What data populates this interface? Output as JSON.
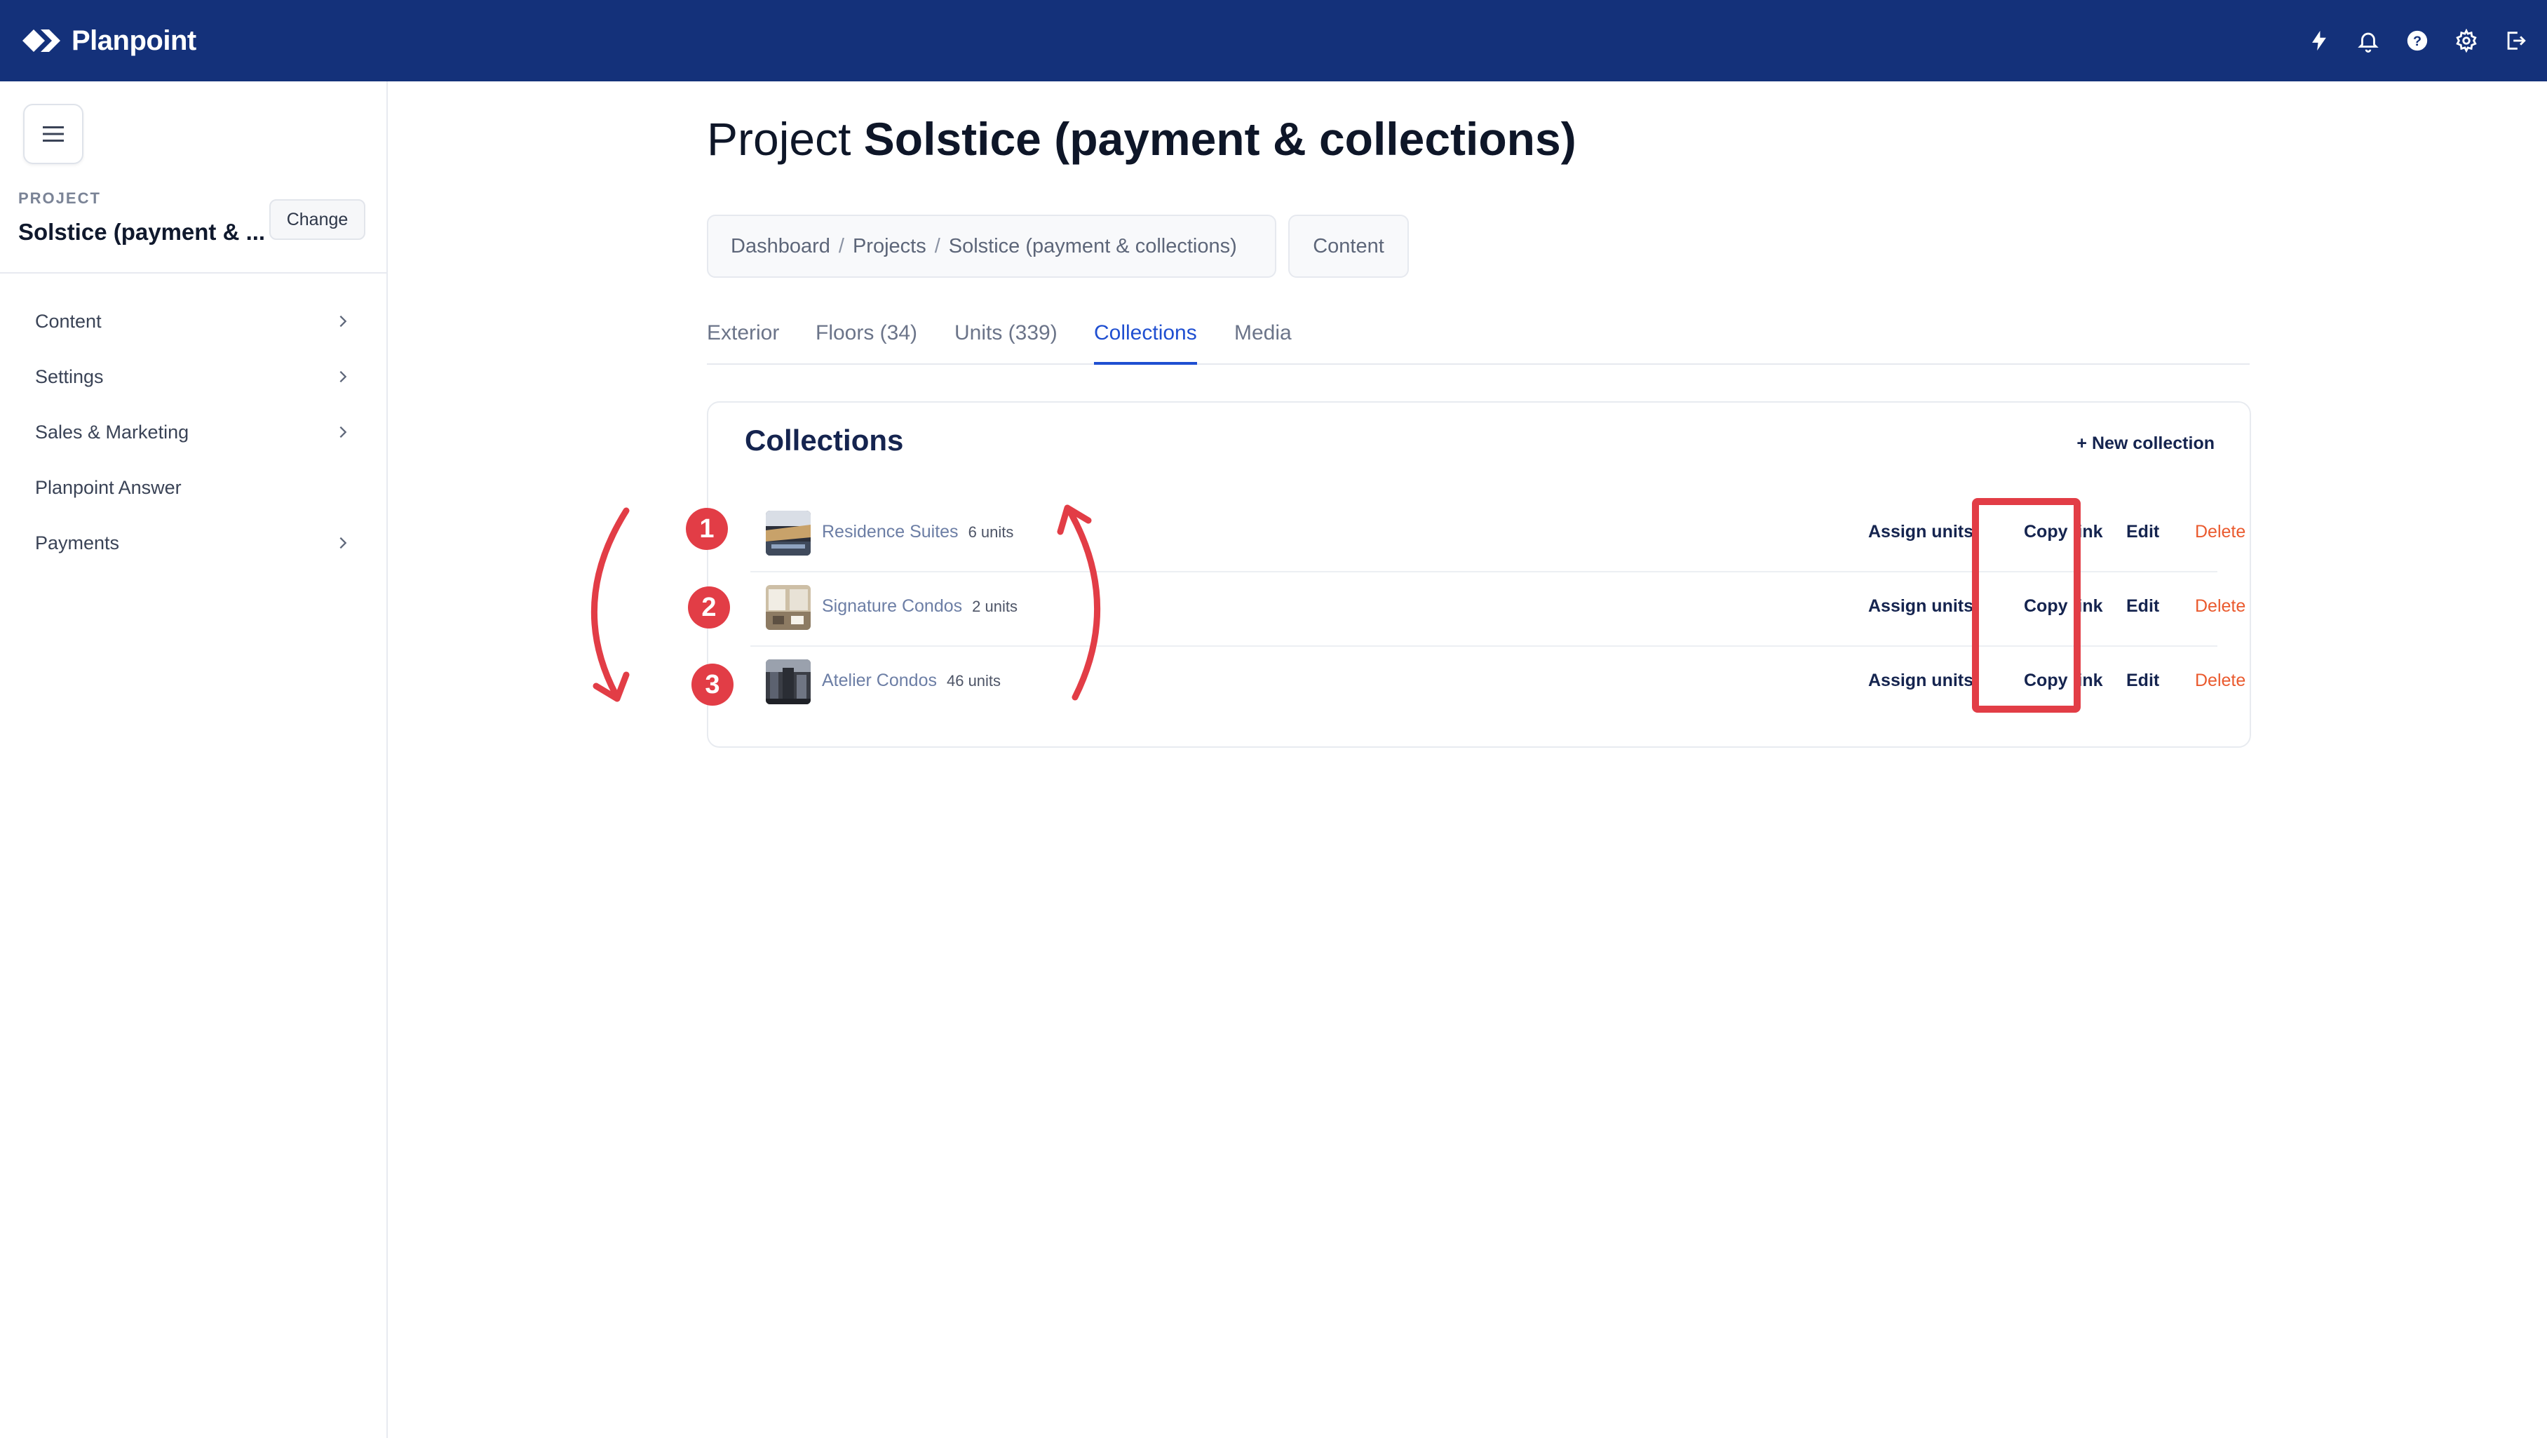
{
  "app": {
    "name": "Planpoint",
    "brand_color": "#14317a",
    "accent_color": "#1f4fd1",
    "top_icons": [
      "lightning-icon",
      "bell-icon",
      "help-icon",
      "gear-icon",
      "logout-icon"
    ]
  },
  "sidebar": {
    "project_label": "PROJECT",
    "project_name": "Solstice (payment & ...",
    "change_label": "Change",
    "items": [
      {
        "label": "Content",
        "has_chevron": true
      },
      {
        "label": "Settings",
        "has_chevron": true
      },
      {
        "label": "Sales & Marketing",
        "has_chevron": true
      },
      {
        "label": "Planpoint Answer",
        "has_chevron": false
      },
      {
        "label": "Payments",
        "has_chevron": true
      }
    ]
  },
  "main": {
    "title_prefix": "Project",
    "title_name": "Solstice (payment & collections)",
    "breadcrumb": [
      "Dashboard",
      "Projects",
      "Solstice (payment & collections)"
    ],
    "breadcrumb_separator": "/",
    "content_chip": "Content",
    "tabs": [
      {
        "label": "Exterior",
        "active": false
      },
      {
        "label": "Floors (34)",
        "active": false
      },
      {
        "label": "Units (339)",
        "active": false
      },
      {
        "label": "Collections",
        "active": true
      },
      {
        "label": "Media",
        "active": false
      }
    ]
  },
  "collections": {
    "title": "Collections",
    "new_label": "+ New collection",
    "actions": {
      "assign": "Assign units",
      "copy": "Copy link",
      "edit": "Edit",
      "delete": "Delete"
    },
    "rows": [
      {
        "number": "1",
        "name": "Residence Suites",
        "units": "6 units"
      },
      {
        "number": "2",
        "name": "Signature Condos",
        "units": "2 units"
      },
      {
        "number": "3",
        "name": "Atelier Condos",
        "units": "46 units"
      }
    ]
  },
  "annotation_color": "#e23d46"
}
